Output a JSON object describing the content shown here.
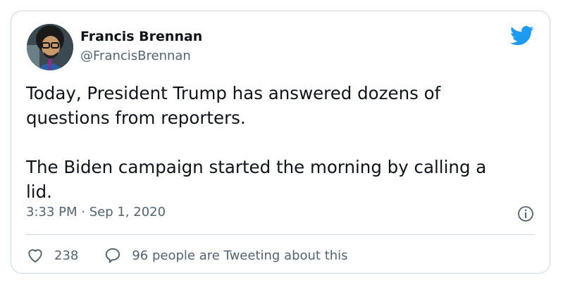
{
  "author": {
    "name": "Francis Brennan",
    "handle": "@FrancisBrennan",
    "avatar_icon": "avatar-cartoon-portrait"
  },
  "tweet": {
    "text": "Today, President Trump has answered dozens of\nquestions from reporters.\n\nThe Biden campaign started the morning by calling a\nlid.",
    "timestamp": "3:33 PM · Sep 1, 2020"
  },
  "actions": {
    "likes": "238",
    "replies_label": "96 people are Tweeting about this"
  },
  "icons": {
    "brand": "twitter-bird-icon",
    "info": "info-icon",
    "like": "heart-icon",
    "reply": "speech-bubble-icon"
  },
  "colors": {
    "brand": "#1d9bf0",
    "text": "#0f1419",
    "secondary": "#536471",
    "border": "#cfd9de"
  }
}
